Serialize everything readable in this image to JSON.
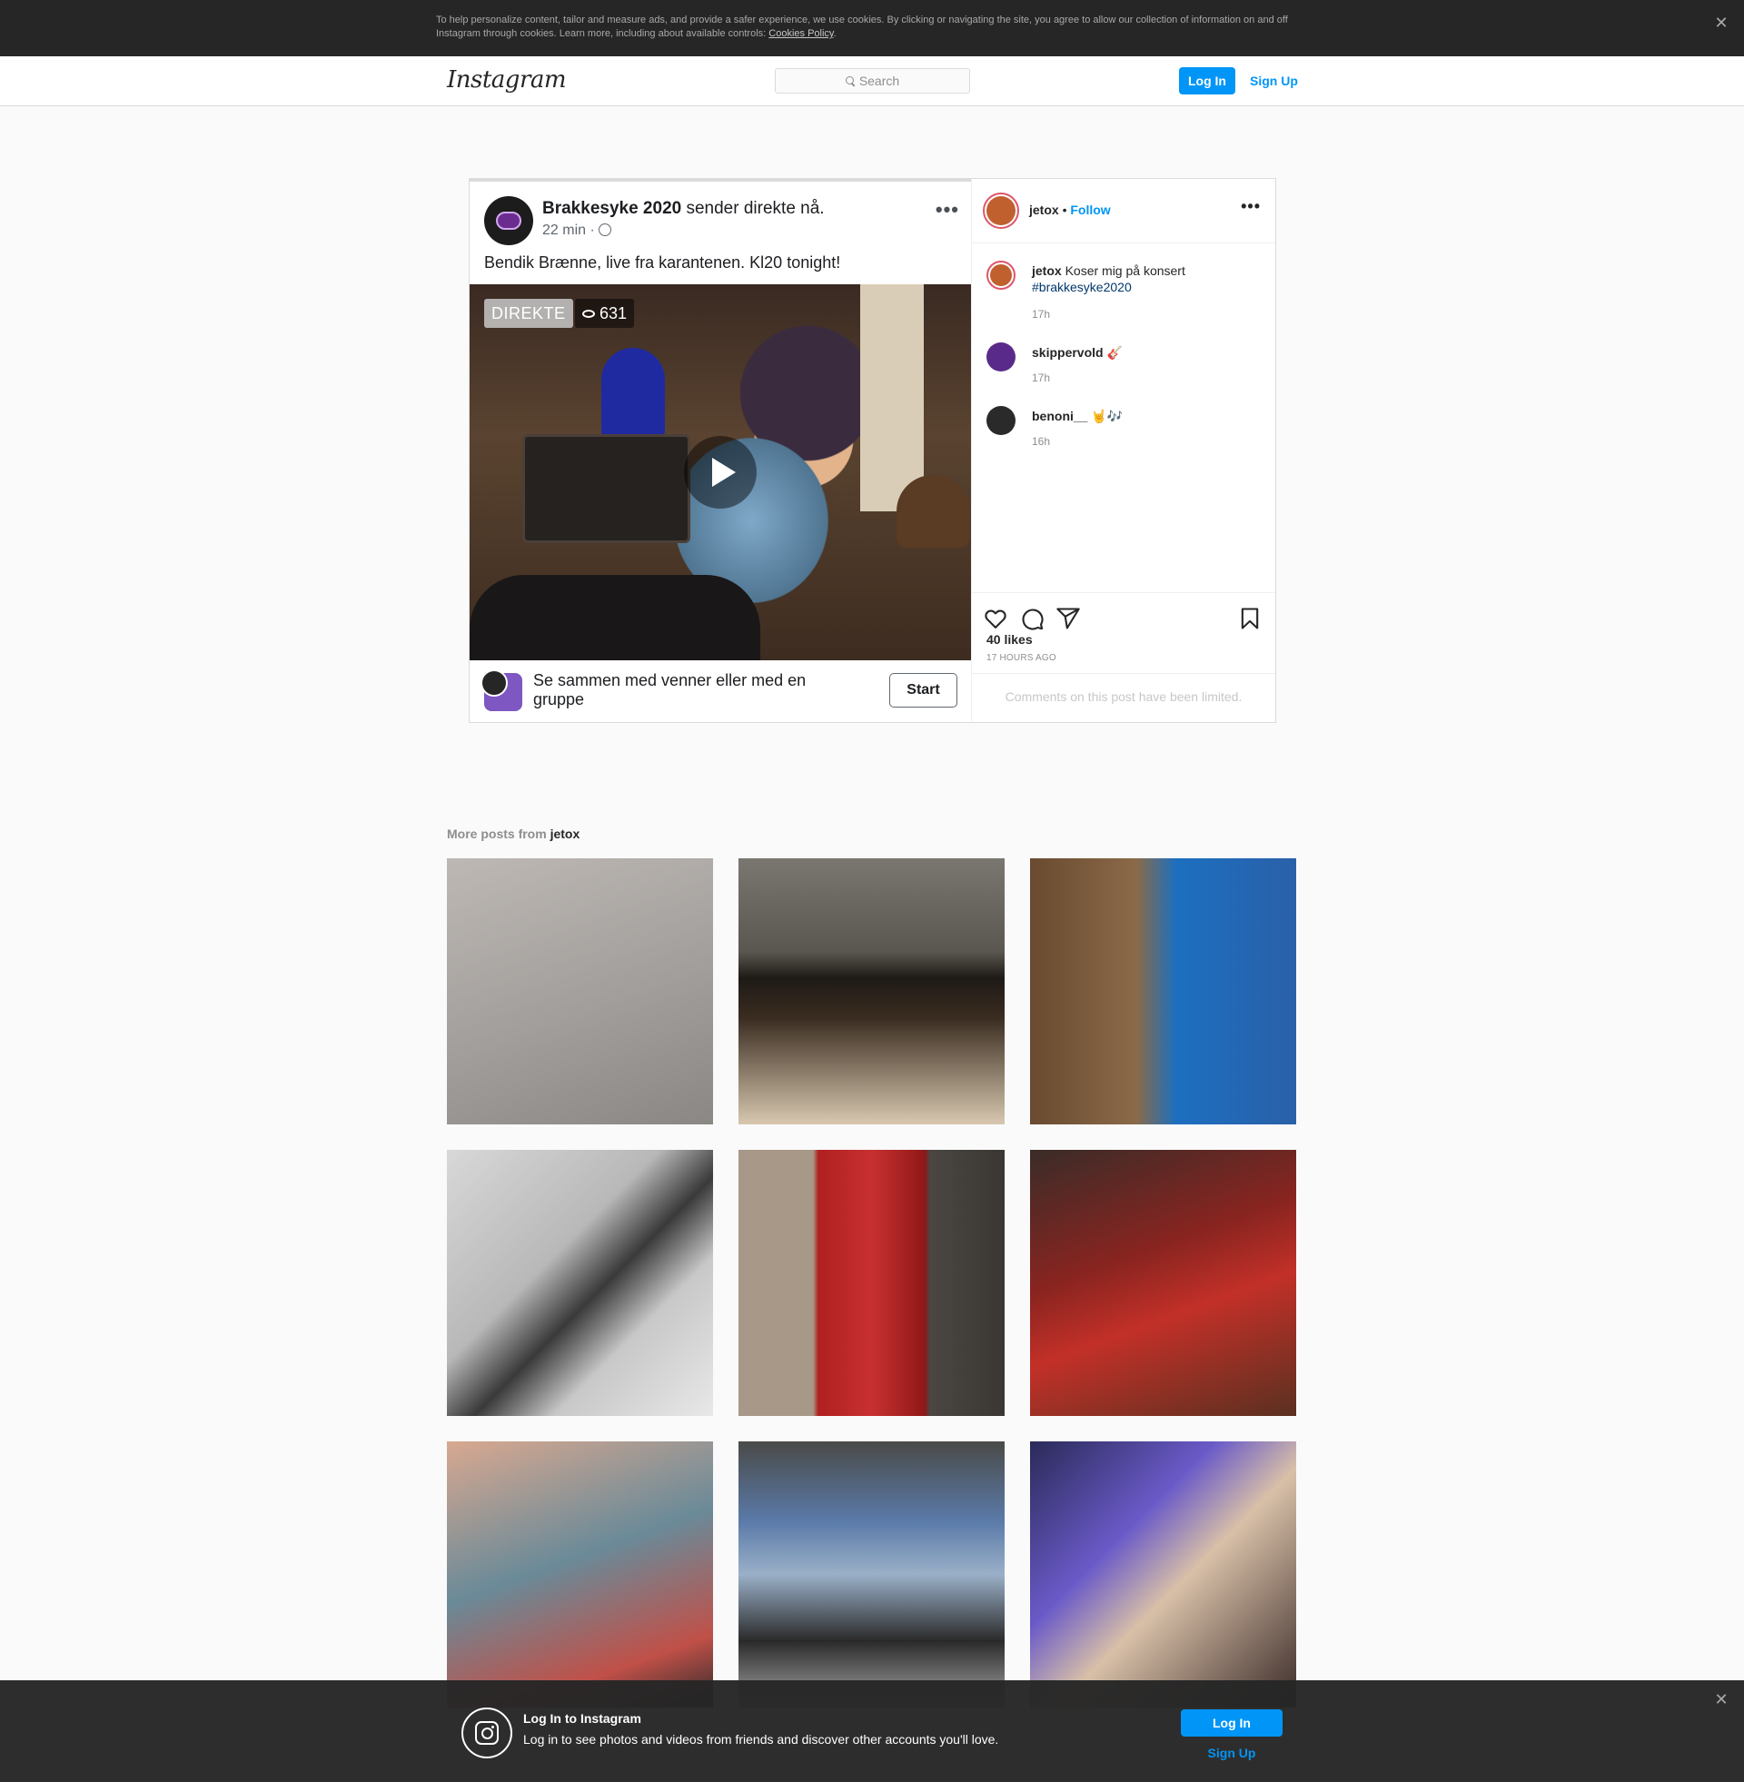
{
  "cookie_banner": {
    "text": "To help personalize content, tailor and measure ads, and provide a safer experience, we use cookies. By clicking or navigating the site, you agree to allow our collection of information on and off Instagram through cookies. Learn more, including about available controls: ",
    "link": "Cookies Policy",
    "suffix": ".",
    "close": "✕"
  },
  "nav": {
    "logo": "Instagram",
    "search_placeholder": "Search",
    "login": "Log In",
    "signup": "Sign Up"
  },
  "post": {
    "embedded": {
      "page_name": "Brakkesyke 2020",
      "title_rest": " sender direkte nå.",
      "meta": "22 min ·",
      "menu": "•••",
      "caption": "Bendik Brænne, live fra karantenen. Kl20 tonight!",
      "live_badge": "DIREKTE",
      "views": "631",
      "footer_text": "Se sammen med venner eller med en gruppe",
      "start_button": "Start"
    },
    "header": {
      "username": "jetox",
      "separator": " • ",
      "follow": "Follow",
      "more": "•••"
    },
    "comments": [
      {
        "user": "jetox",
        "text": " Koser mig på konsert ",
        "tag": "#brakkesyke2020",
        "time": "17h",
        "avatar_color": "#c0602f"
      },
      {
        "user": "skippervold",
        "text": " 🎸",
        "tag": "",
        "time": "17h",
        "avatar_color": "#5a2a8a"
      },
      {
        "user": "benoni__",
        "text": " 🤘🎶",
        "tag": "",
        "time": "16h",
        "avatar_color": "#2a2a2a"
      }
    ],
    "likes": "40 likes",
    "time_ago": "17 HOURS AGO",
    "comments_limited": "Comments on this post have been limited."
  },
  "more_posts": {
    "prefix": "More posts from ",
    "username": "jetox",
    "tiles": [
      {
        "label": "toilet-paper-holder",
        "bg": "linear-gradient(160deg,#bdb8b4 0%,#a29e9b 55%,#8a8784 100%)"
      },
      {
        "label": "captain-hat",
        "bg": "linear-gradient(180deg,#7a7670 0%,#5a5650 35%,#1e1a16 45%,#3a2c20 60%,#d8c8b0 100%)"
      },
      {
        "label": "committee-photo",
        "bg": "linear-gradient(90deg,#6a4a30 0%,#8a6a48 40%,#1c6fc0 55%,#2a60a8 100%)"
      },
      {
        "label": "graffiti-wall",
        "bg": "linear-gradient(135deg,#d8d8d8 0%,#b8b8b8 40%,#3a3a3a 55%,#c8c8c8 70%,#e8e8e8 100%)"
      },
      {
        "label": "red-bench",
        "bg": "linear-gradient(90deg,#a89888 0%,#a89888 28%,#b02020 30%,#c83030 50%,#901818 70%,#4a4642 72%,#3a3632 100%)"
      },
      {
        "label": "christmas-record",
        "bg": "linear-gradient(160deg,#3a2c28 0%,#8a2420 40%,#c23028 60%,#5a3020 100%)"
      },
      {
        "label": "tattoo-arm",
        "bg": "linear-gradient(160deg,#d8a890 0%,#6a8a98 45%,#c05048 80%,#2a2a2a 100%)"
      },
      {
        "label": "laptop-screen",
        "bg": "linear-gradient(180deg,#4a4a48 0%,#5a7aa8 30%,#9ab0c8 50%,#2a2a2a 75%,#a8a8a8 100%)"
      },
      {
        "label": "blurry-party",
        "bg": "linear-gradient(135deg,#2a2a58 0%,#6a5ac8 35%,#d8c0a8 55%,#3a2a28 100%)"
      }
    ]
  },
  "bottom_banner": {
    "title": "Log In to Instagram",
    "text": "Log in to see photos and videos from friends and discover other accounts you'll love.",
    "login": "Log In",
    "signup": "Sign Up",
    "close": "✕"
  },
  "colors": {
    "accent": "#0095f6",
    "text": "#262626",
    "muted": "#8e8e8e"
  }
}
